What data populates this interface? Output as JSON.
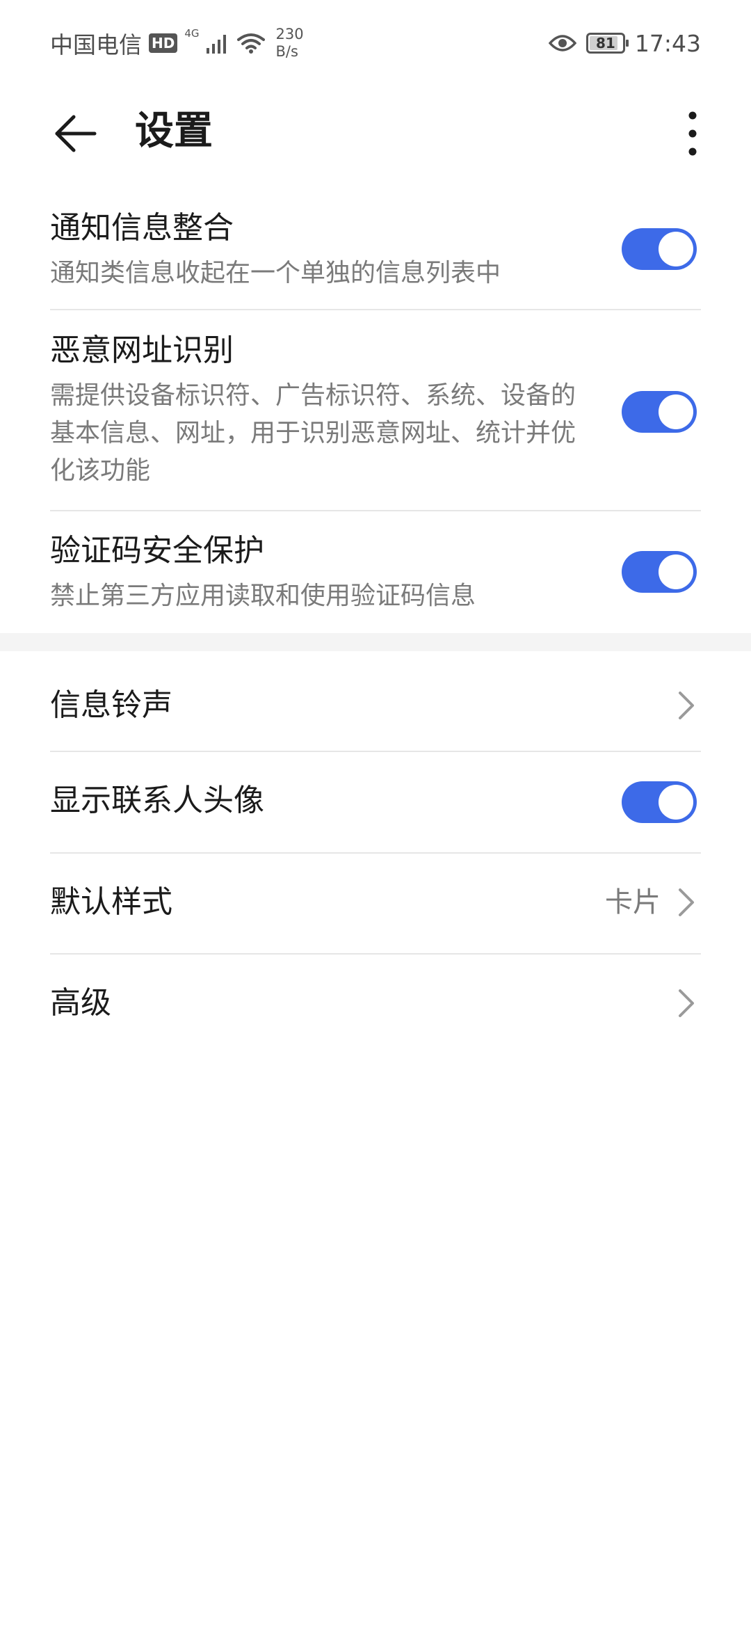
{
  "status_bar": {
    "carrier": "中国电信",
    "hd": "HD",
    "network": "4G",
    "speed_value": "230",
    "speed_unit": "B/s",
    "battery": "81",
    "time": "17:43"
  },
  "header": {
    "title": "设置"
  },
  "notification_merge": {
    "title": "通知信息整合",
    "desc": "通知类信息收起在一个单独的信息列表中",
    "enabled": true
  },
  "malicious_url": {
    "title": "恶意网址识别",
    "desc": "需提供设备标识符、广告标识符、系统、设备的基本信息、网址，用于识别恶意网址、统计并优化该功能",
    "enabled": true
  },
  "code_protection": {
    "title": "验证码安全保护",
    "desc": "禁止第三方应用读取和使用验证码信息",
    "enabled": true
  },
  "ringtone": {
    "title": "信息铃声"
  },
  "contact_avatar": {
    "title": "显示联系人头像",
    "enabled": true
  },
  "default_style": {
    "title": "默认样式",
    "value": "卡片"
  },
  "advanced": {
    "title": "高级"
  },
  "colors": {
    "accent": "#3d6ae8",
    "secondary_text": "#7a7a7a",
    "divider": "#e6e6e6"
  }
}
